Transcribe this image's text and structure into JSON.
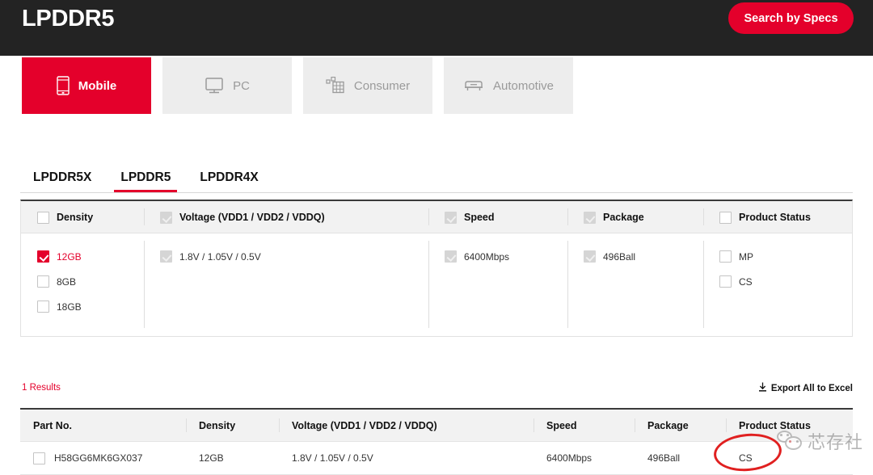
{
  "header": {
    "title": "LPDDR5",
    "search_button": "Search by Specs"
  },
  "category_tabs": [
    {
      "label": "Mobile",
      "icon": "phone-icon",
      "active": true
    },
    {
      "label": "PC",
      "icon": "monitor-icon",
      "active": false
    },
    {
      "label": "Consumer",
      "icon": "blocks-icon",
      "active": false
    },
    {
      "label": "Automotive",
      "icon": "car-icon",
      "active": false
    }
  ],
  "type_tabs": [
    {
      "label": "LPDDR5X",
      "active": false
    },
    {
      "label": "LPDDR5",
      "active": true
    },
    {
      "label": "LPDDR4X",
      "active": false
    }
  ],
  "filters": [
    {
      "header": "Density",
      "header_state": "unchecked",
      "options": [
        {
          "label": "12GB",
          "state": "checked"
        },
        {
          "label": "8GB",
          "state": "unchecked"
        },
        {
          "label": "18GB",
          "state": "unchecked"
        }
      ]
    },
    {
      "header": "Voltage (VDD1 / VDD2 / VDDQ)",
      "header_state": "disabled-checked",
      "options": [
        {
          "label": "1.8V / 1.05V / 0.5V",
          "state": "disabled-checked"
        }
      ]
    },
    {
      "header": "Speed",
      "header_state": "disabled-checked",
      "options": [
        {
          "label": "6400Mbps",
          "state": "disabled-checked"
        }
      ]
    },
    {
      "header": "Package",
      "header_state": "disabled-checked",
      "options": [
        {
          "label": "496Ball",
          "state": "disabled-checked"
        }
      ]
    },
    {
      "header": "Product Status",
      "header_state": "unchecked",
      "options": [
        {
          "label": "MP",
          "state": "unchecked"
        },
        {
          "label": "CS",
          "state": "unchecked"
        }
      ]
    }
  ],
  "results": {
    "count_label": "1 Results",
    "export_label": "Export All to Excel",
    "export_icon": "download-icon",
    "columns": [
      "Part No.",
      "Density",
      "Voltage (VDD1 / VDD2 / VDDQ)",
      "Speed",
      "Package",
      "Product Status"
    ],
    "rows": [
      {
        "part_no": "H58GG6MK6GX037",
        "density": "12GB",
        "voltage": "1.8V / 1.05V / 0.5V",
        "speed": "6400Mbps",
        "package": "496Ball",
        "product_status": "CS"
      }
    ]
  },
  "annotations": {
    "highlight_ellipse": "red-ellipse-around-cs",
    "watermark_text": "芯存社",
    "watermark_logo": "wechat-logo-icon"
  },
  "colors": {
    "brand_red": "#e4002b",
    "header_bg": "#232323",
    "annotation_red": "#e02020"
  }
}
